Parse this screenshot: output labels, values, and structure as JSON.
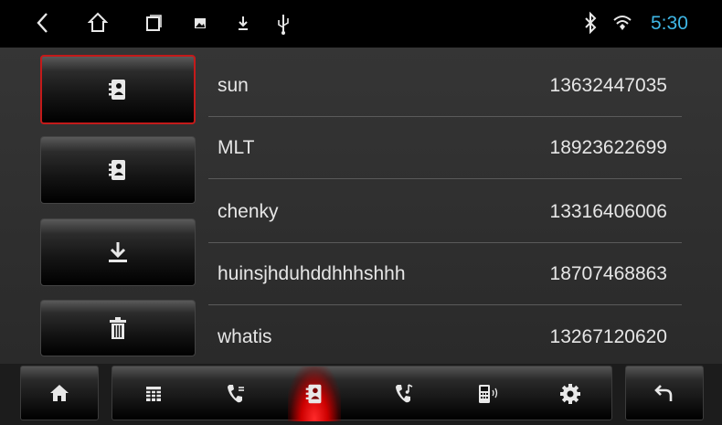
{
  "status_bar": {
    "time": "5:30",
    "icons": [
      "back-icon",
      "home-icon",
      "recent-apps-icon",
      "image-icon",
      "download-icon",
      "usb-icon",
      "bluetooth-icon",
      "wifi-icon"
    ]
  },
  "side_buttons": [
    {
      "icon": "phonebook-icon",
      "active": true
    },
    {
      "icon": "phonebook-icon",
      "active": false
    },
    {
      "icon": "download-icon",
      "active": false
    },
    {
      "icon": "trash-icon",
      "active": false
    }
  ],
  "contacts": [
    {
      "name": "sun",
      "number": "13632447035"
    },
    {
      "name": "MLT",
      "number": "18923622699"
    },
    {
      "name": "chenky",
      "number": "13316406006"
    },
    {
      "name": "huinsjhduhddhhhshhh",
      "number": "18707468863"
    },
    {
      "name": "whatis",
      "number": "13267120620"
    }
  ],
  "bottom_bar": {
    "tabs": [
      "dialpad-icon",
      "call-log-icon",
      "contacts-icon",
      "music-icon",
      "device-icon",
      "settings-icon"
    ],
    "active_tab": "contacts-icon",
    "accent_color": "#e01010"
  },
  "colors": {
    "time": "#3fb7e6",
    "active_border": "#c41a1a"
  }
}
